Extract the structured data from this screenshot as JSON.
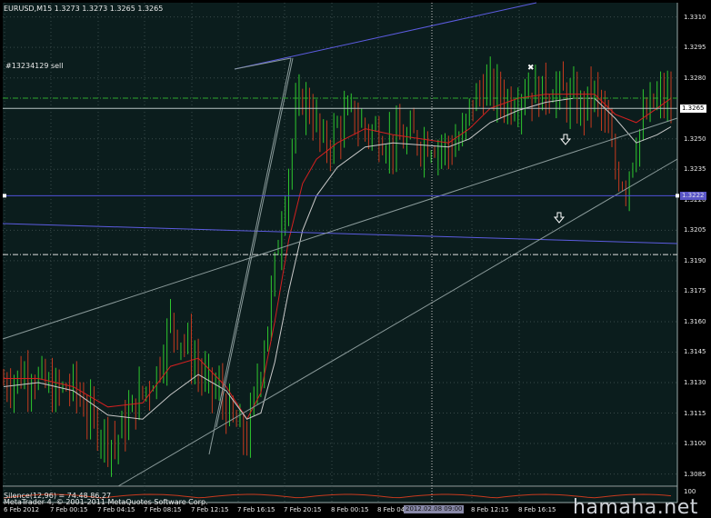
{
  "window": {
    "symbol_line": "EURUSD,M15  1.3273 1.3273 1.3265 1.3265",
    "order_label": "#13234129 sell",
    "oscillator_label": "Silence(12,96) = 74.48 86.27",
    "copyright": "MetaTrader 4, © 2001-2011 MetaQuotes Software Corp.",
    "oscillator_level": "100",
    "watermark": "hamaha.net"
  },
  "colors": {
    "background": "#000000",
    "chart_area": "#0b1d1d",
    "grid": "#3a4a4a",
    "axis_text": "#e8e8e8",
    "bull_candle": "#2ec82e",
    "bear_candle": "#c83a1e",
    "ma_fast": "#d42020",
    "ma_slow": "#c8c8c8",
    "channel_line": "#5c5ce0",
    "horizontal_level": "#5050d8",
    "order_line": "#2ea82e",
    "price_tag_bg": "#5a56c8"
  },
  "chart_data": {
    "type": "candlestick",
    "symbol": "EURUSD",
    "timeframe": "M15",
    "ohlc_header": {
      "open": 1.3273,
      "high": 1.3273,
      "low": 1.3265,
      "close": 1.3265
    },
    "price_labels": [
      "1.3310",
      "1.3295",
      "1.3280",
      "1.3265",
      "1.3250",
      "1.3235",
      "1.3220",
      "1.3205",
      "1.3190",
      "1.3175",
      "1.3160",
      "1.3145",
      "1.3130",
      "1.3115",
      "1.3100",
      "1.3085"
    ],
    "price_ticks": [
      1.331,
      1.3295,
      1.328,
      1.325,
      1.3235,
      1.3205,
      1.319,
      1.3175,
      1.316,
      1.3145,
      1.313,
      1.3115,
      1.31,
      1.3085
    ],
    "current_price": {
      "value": 1.3265,
      "label": "1.3265"
    },
    "level_price": {
      "value": 1.3222,
      "label": "1.3222"
    },
    "ylim": [
      1.3079,
      1.3317
    ],
    "time_labels": [
      "6 Feb 2012",
      "7 Feb 00:15",
      "7 Feb 04:15",
      "7 Feb 08:15",
      "7 Feb 12:15",
      "7 Feb 16:15",
      "7 Feb 20:15",
      "8 Feb 00:15",
      "8 Feb 04",
      "8 Feb 12:15",
      "8 Feb 16:15"
    ],
    "time_tag": "2012.02.08 09:00",
    "order": {
      "ticket": "#13234129",
      "side": "sell",
      "price": 1.327
    },
    "horizontal_level_price": 1.3222,
    "dash_level_price": 1.3193,
    "annotations": [
      "down-arrow",
      "down-arrow",
      "order-marker"
    ],
    "series": [
      {
        "kind": "candles",
        "anchors": [
          [
            0,
            1.313
          ],
          [
            8,
            1.3135
          ],
          [
            14,
            1.3125
          ],
          [
            20,
            1.3128
          ],
          [
            26,
            1.311
          ],
          [
            32,
            1.31
          ],
          [
            38,
            1.312
          ],
          [
            44,
            1.3135
          ],
          [
            48,
            1.316
          ],
          [
            52,
            1.315
          ],
          [
            58,
            1.313
          ],
          [
            62,
            1.3125
          ],
          [
            66,
            1.311
          ],
          [
            70,
            1.3102
          ],
          [
            73,
            1.313
          ],
          [
            76,
            1.316
          ],
          [
            79,
            1.32
          ],
          [
            82,
            1.3235
          ],
          [
            84,
            1.326
          ],
          [
            86,
            1.327
          ],
          [
            89,
            1.3262
          ],
          [
            92,
            1.3245
          ],
          [
            96,
            1.3255
          ],
          [
            100,
            1.3262
          ],
          [
            104,
            1.3255
          ],
          [
            108,
            1.3252
          ],
          [
            112,
            1.3248
          ],
          [
            118,
            1.325
          ],
          [
            124,
            1.3248
          ],
          [
            128,
            1.3245
          ],
          [
            132,
            1.325
          ],
          [
            134,
            1.3265
          ],
          [
            138,
            1.3275
          ],
          [
            142,
            1.3272
          ],
          [
            146,
            1.3268
          ],
          [
            150,
            1.3275
          ],
          [
            154,
            1.3272
          ],
          [
            158,
            1.3275
          ],
          [
            162,
            1.327
          ],
          [
            166,
            1.3265
          ],
          [
            170,
            1.3272
          ],
          [
            173,
            1.3258
          ],
          [
            176,
            1.3235
          ],
          [
            179,
            1.3228
          ],
          [
            182,
            1.325
          ],
          [
            186,
            1.3265
          ],
          [
            189,
            1.327
          ],
          [
            192,
            1.3268
          ]
        ]
      },
      {
        "kind": "ma_fast",
        "points": [
          [
            0,
            1.3132
          ],
          [
            10,
            1.3132
          ],
          [
            20,
            1.3128
          ],
          [
            30,
            1.3118
          ],
          [
            40,
            1.312
          ],
          [
            48,
            1.3138
          ],
          [
            56,
            1.3142
          ],
          [
            64,
            1.3128
          ],
          [
            70,
            1.3112
          ],
          [
            74,
            1.3125
          ],
          [
            78,
            1.316
          ],
          [
            82,
            1.32
          ],
          [
            86,
            1.3228
          ],
          [
            90,
            1.324
          ],
          [
            96,
            1.3248
          ],
          [
            104,
            1.3255
          ],
          [
            112,
            1.3252
          ],
          [
            120,
            1.325
          ],
          [
            128,
            1.3248
          ],
          [
            134,
            1.3255
          ],
          [
            140,
            1.3265
          ],
          [
            148,
            1.327
          ],
          [
            156,
            1.3272
          ],
          [
            164,
            1.3272
          ],
          [
            170,
            1.3272
          ],
          [
            176,
            1.3262
          ],
          [
            182,
            1.3258
          ],
          [
            188,
            1.3265
          ],
          [
            192,
            1.327
          ]
        ]
      },
      {
        "kind": "ma_slow",
        "points": [
          [
            0,
            1.3128
          ],
          [
            10,
            1.313
          ],
          [
            20,
            1.3126
          ],
          [
            30,
            1.3114
          ],
          [
            40,
            1.3112
          ],
          [
            48,
            1.3124
          ],
          [
            56,
            1.3134
          ],
          [
            64,
            1.3126
          ],
          [
            70,
            1.3112
          ],
          [
            74,
            1.3115
          ],
          [
            78,
            1.314
          ],
          [
            82,
            1.3175
          ],
          [
            86,
            1.3205
          ],
          [
            90,
            1.3222
          ],
          [
            96,
            1.3236
          ],
          [
            104,
            1.3246
          ],
          [
            112,
            1.3248
          ],
          [
            120,
            1.3247
          ],
          [
            128,
            1.3246
          ],
          [
            134,
            1.325
          ],
          [
            140,
            1.3258
          ],
          [
            148,
            1.3264
          ],
          [
            156,
            1.3268
          ],
          [
            164,
            1.327
          ],
          [
            170,
            1.327
          ],
          [
            176,
            1.326
          ],
          [
            182,
            1.3248
          ],
          [
            188,
            1.3252
          ],
          [
            192,
            1.3256
          ]
        ]
      }
    ]
  }
}
